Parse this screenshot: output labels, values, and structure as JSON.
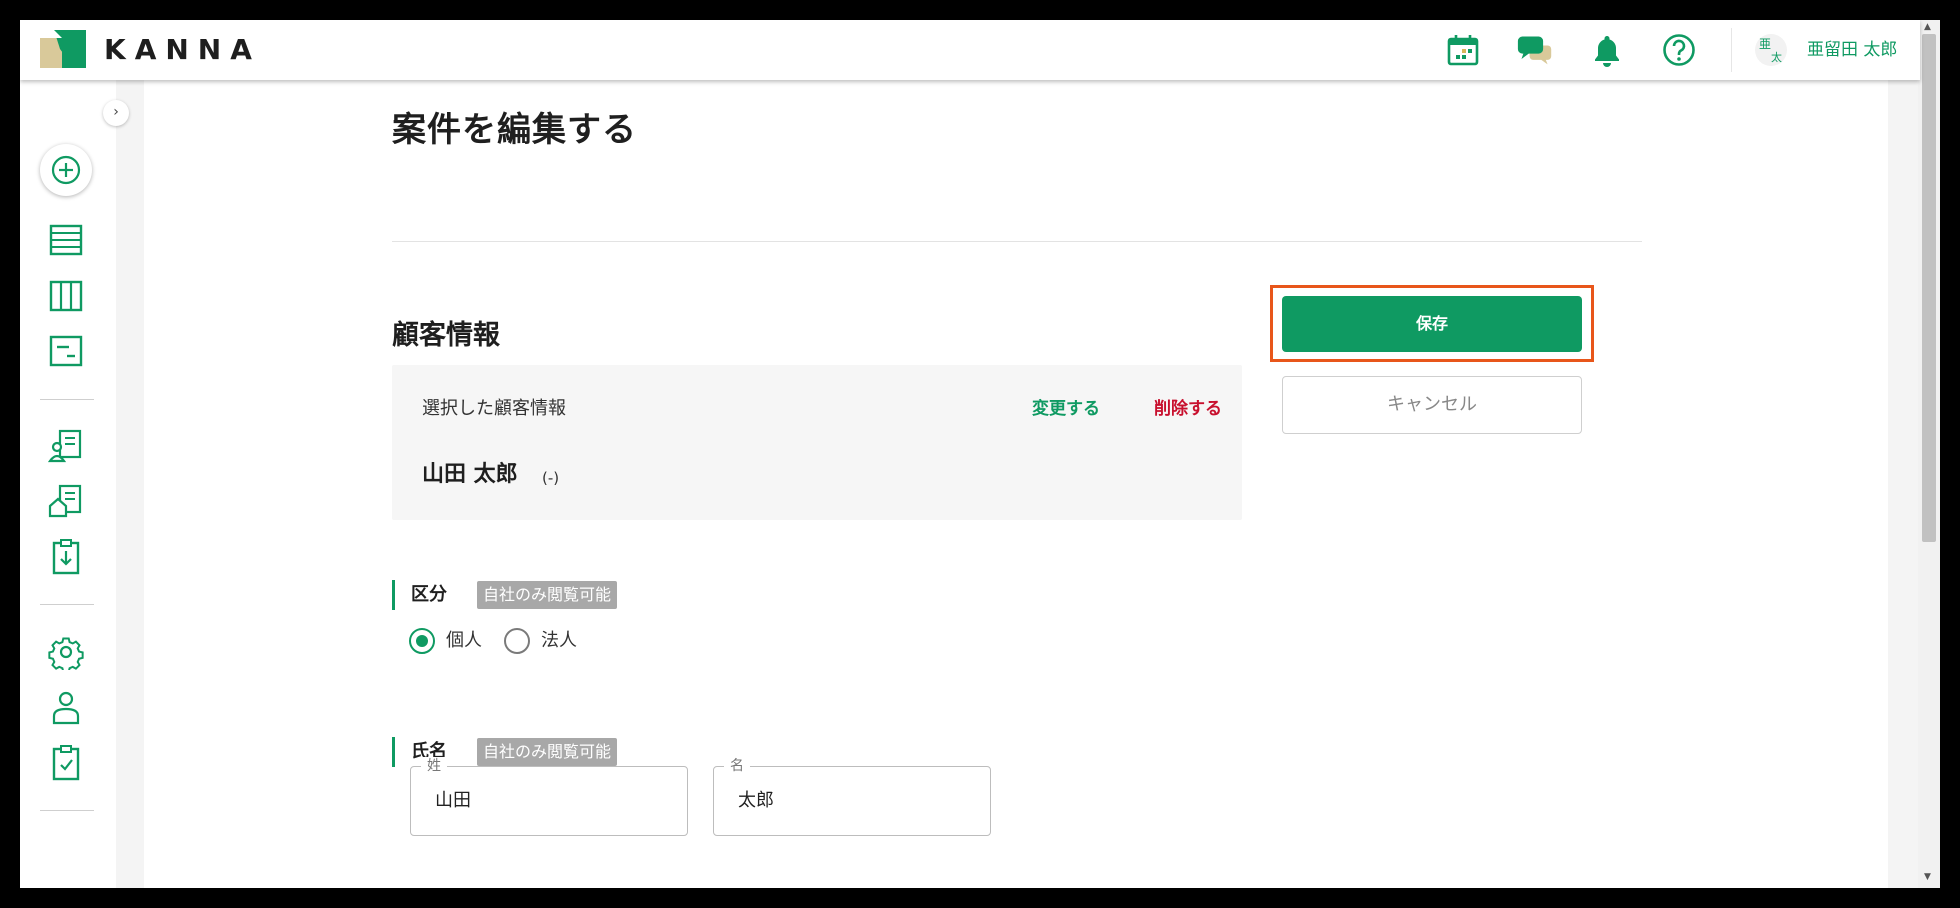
{
  "header": {
    "brand": "KANNA",
    "icons": [
      "calendar-icon",
      "chat-icon",
      "bell-icon",
      "help-icon"
    ],
    "user": {
      "avatar_line1": "亜",
      "avatar_line2": "太",
      "name": "亜留田 太郎"
    }
  },
  "sidebar": {
    "collapse_glyph": "›",
    "items": [
      "add-icon",
      "list-icon",
      "board-icon",
      "report-icon",
      "customer-doc-icon",
      "property-doc-icon",
      "download-clipboard-icon",
      "settings-icon",
      "user-icon",
      "checklist-icon"
    ]
  },
  "page": {
    "title": "案件を編集する"
  },
  "customer": {
    "section_title": "顧客情報",
    "card_label": "選択した顧客情報",
    "change_label": "変更する",
    "delete_label": "削除する",
    "name": "山田 太郎",
    "sub": "(-)"
  },
  "category": {
    "label": "区分",
    "badge": "自社のみ閲覧可能",
    "options": [
      {
        "label": "個人",
        "selected": true
      },
      {
        "label": "法人",
        "selected": false
      }
    ]
  },
  "fullname": {
    "label": "氏名",
    "badge": "自社のみ閲覧可能",
    "last": {
      "legend": "姓",
      "value": "山田"
    },
    "first": {
      "legend": "名",
      "value": "太郎"
    }
  },
  "actions": {
    "save_label": "保存",
    "cancel_label": "キャンセル"
  },
  "colors": {
    "accent": "#0f9a62",
    "delete": "#c8102e",
    "highlight": "#e8561a"
  }
}
